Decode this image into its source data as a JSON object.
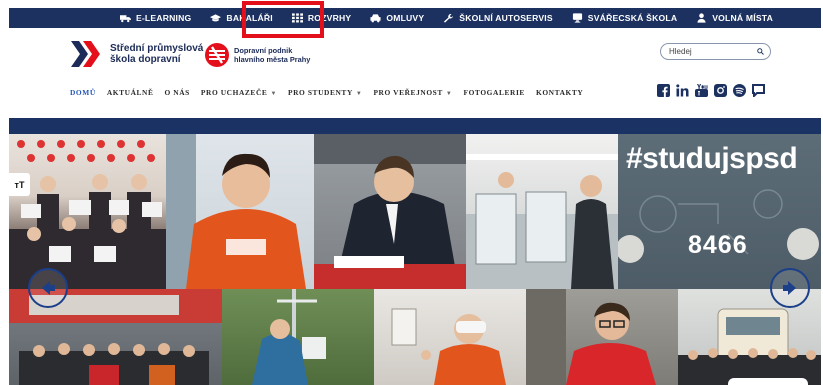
{
  "topbar": {
    "links": [
      {
        "label": "E-LEARNING",
        "icon": "truck-icon"
      },
      {
        "label": "BAKALÁŘI",
        "icon": "graduation-cap-icon"
      },
      {
        "label": "ROZVRHY",
        "icon": "grid-icon"
      },
      {
        "label": "OMLUVY",
        "icon": "car-icon"
      },
      {
        "label": "ŠKOLNÍ AUTOSERVIS",
        "icon": "wrench-icon"
      },
      {
        "label": "SVÁŘECSKÁ ŠKOLA",
        "icon": "monitor-icon"
      },
      {
        "label": "VOLNÁ MÍSTA",
        "icon": "person-icon"
      }
    ],
    "highlight_color": "#e3101c",
    "bar_color": "#1c3160"
  },
  "header": {
    "school_name_line1": "Střední průmyslová",
    "school_name_line2": "škola dopravní",
    "partner_line1": "Dopravní podnik",
    "partner_line2": "hlavního města Prahy"
  },
  "search": {
    "placeholder": "Hledej"
  },
  "nav": {
    "items": [
      {
        "label": "DOMŮ",
        "active": true,
        "dropdown": false
      },
      {
        "label": "AKTUÁLNĚ",
        "active": false,
        "dropdown": false
      },
      {
        "label": "O NÁS",
        "active": false,
        "dropdown": false
      },
      {
        "label": "PRO UCHAZEČE",
        "active": false,
        "dropdown": true
      },
      {
        "label": "PRO STUDENTY",
        "active": false,
        "dropdown": true
      },
      {
        "label": "PRO VEŘEJNOST",
        "active": false,
        "dropdown": true
      },
      {
        "label": "FOTOGALERIE",
        "active": false,
        "dropdown": false
      },
      {
        "label": "KONTAKTY",
        "active": false,
        "dropdown": false
      }
    ],
    "active_color": "#2355b7"
  },
  "socials": [
    "facebook-icon",
    "linkedin-icon",
    "youtube-icon",
    "instagram-icon",
    "spotify-icon",
    "chat-icon"
  ],
  "hero": {
    "hashtag": "#studujspsd",
    "tram_number": "8466",
    "text_size_label": "тT"
  }
}
